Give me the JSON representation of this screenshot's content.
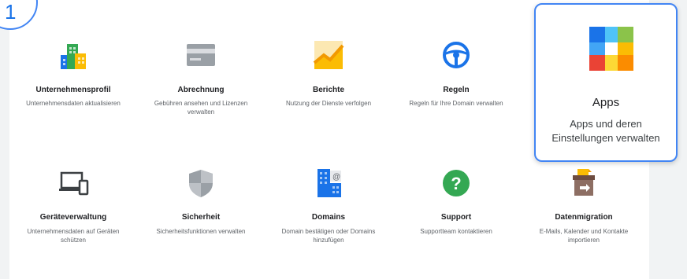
{
  "step_badge": "1",
  "tiles_row1": [
    {
      "title": "Unternehmensprofil",
      "desc": "Unternehmensdaten aktualisieren",
      "icon": "company-profile-icon"
    },
    {
      "title": "Abrechnung",
      "desc": "Gebühren ansehen und Lizenzen verwalten",
      "icon": "billing-card-icon"
    },
    {
      "title": "Berichte",
      "desc": "Nutzung der Dienste verfolgen",
      "icon": "reports-chart-icon"
    },
    {
      "title": "Regeln",
      "desc": "Regeln für Ihre Domain verwalten",
      "icon": "rules-steering-wheel-icon"
    }
  ],
  "tiles_row2": [
    {
      "title": "Geräteverwaltung",
      "desc": "Unternehmensdaten auf Geräten schützen",
      "icon": "devices-icon"
    },
    {
      "title": "Sicherheit",
      "desc": "Sicherheitsfunktionen verwalten",
      "icon": "security-shield-icon"
    },
    {
      "title": "Domains",
      "desc": "Domain bestätigen oder Domains hinzufügen",
      "icon": "domains-icon"
    },
    {
      "title": "Support",
      "desc": "Supportteam kontaktieren",
      "icon": "support-question-icon"
    },
    {
      "title": "Datenmigration",
      "desc": "E-Mails, Kalender und Kontakte importieren",
      "icon": "data-migration-icon"
    }
  ],
  "apps_callout": {
    "title": "Apps",
    "desc": "Apps und deren Einstellungen verwalten",
    "icon": "apps-grid-icon"
  },
  "colors": {
    "accent_blue": "#4285f4",
    "google_red": "#ea4335",
    "google_yellow": "#fbbc04",
    "google_green": "#34a853"
  }
}
